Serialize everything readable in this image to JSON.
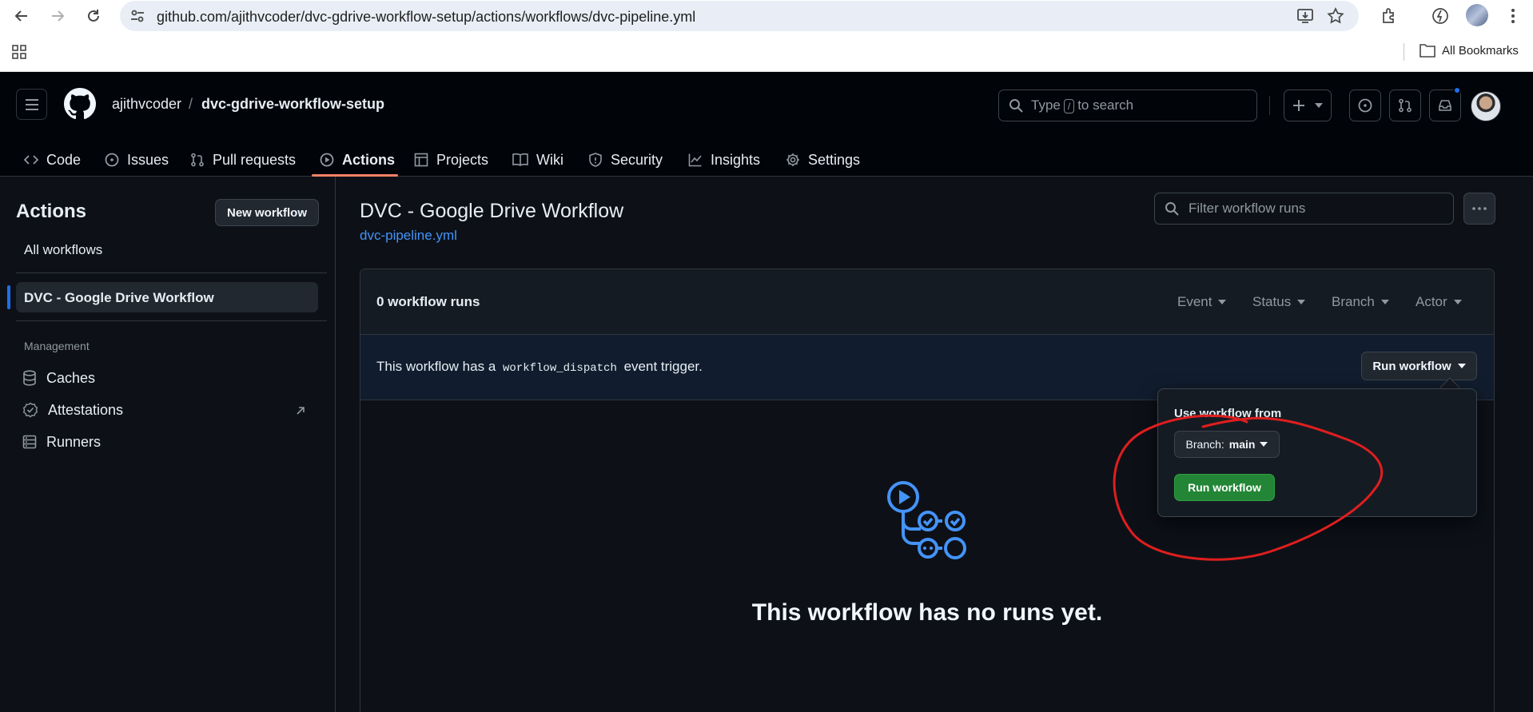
{
  "browser": {
    "url": "github.com/ajithvcoder/dvc-gdrive-workflow-setup/actions/workflows/dvc-pipeline.yml",
    "bookmarks_label": "All Bookmarks"
  },
  "header": {
    "owner": "ajithvcoder",
    "separator": "/",
    "repo": "dvc-gdrive-workflow-setup",
    "search_prefix": "Type",
    "search_key": "/",
    "search_suffix": "to search"
  },
  "tabs": [
    {
      "label": "Code",
      "icon": "code-icon"
    },
    {
      "label": "Issues",
      "icon": "issue-icon"
    },
    {
      "label": "Pull requests",
      "icon": "pull-request-icon"
    },
    {
      "label": "Actions",
      "icon": "play-icon",
      "active": true
    },
    {
      "label": "Projects",
      "icon": "table-icon"
    },
    {
      "label": "Wiki",
      "icon": "book-icon"
    },
    {
      "label": "Security",
      "icon": "shield-icon"
    },
    {
      "label": "Insights",
      "icon": "graph-icon"
    },
    {
      "label": "Settings",
      "icon": "gear-icon"
    }
  ],
  "sidebar": {
    "title": "Actions",
    "new_workflow": "New workflow",
    "all_workflows": "All workflows",
    "active_workflow": "DVC - Google Drive Workflow",
    "management_heading": "Management",
    "items": [
      {
        "label": "Caches",
        "icon": "database-icon"
      },
      {
        "label": "Attestations",
        "icon": "verified-icon"
      },
      {
        "label": "Runners",
        "icon": "server-icon"
      }
    ]
  },
  "main": {
    "title": "DVC - Google Drive Workflow",
    "file": "dvc-pipeline.yml",
    "filter_placeholder": "Filter workflow runs",
    "runs_count": "0 workflow runs",
    "filters": [
      "Event",
      "Status",
      "Branch",
      "Actor"
    ],
    "dispatch_prefix": "This workflow has a",
    "dispatch_code": "workflow_dispatch",
    "dispatch_suffix": "event trigger.",
    "run_workflow_button": "Run workflow",
    "empty_message": "This workflow has no runs yet."
  },
  "dropdown": {
    "label": "Use workflow from",
    "branch_prefix": "Branch:",
    "branch_name": "main",
    "run_button": "Run workflow"
  },
  "colors": {
    "accent_blue": "#1f6feb",
    "link_blue": "#4493f8",
    "green_button": "#238636",
    "tab_underline": "#f78166",
    "annotation_red": "#e01e1e"
  }
}
